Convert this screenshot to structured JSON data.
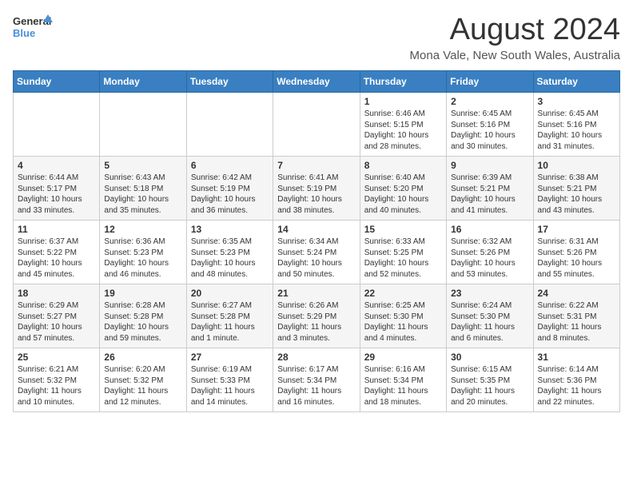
{
  "logo": {
    "general": "General",
    "blue": "Blue"
  },
  "title": "August 2024",
  "location": "Mona Vale, New South Wales, Australia",
  "days_header": [
    "Sunday",
    "Monday",
    "Tuesday",
    "Wednesday",
    "Thursday",
    "Friday",
    "Saturday"
  ],
  "weeks": [
    [
      {
        "day": "",
        "content": ""
      },
      {
        "day": "",
        "content": ""
      },
      {
        "day": "",
        "content": ""
      },
      {
        "day": "",
        "content": ""
      },
      {
        "day": "1",
        "content": "Sunrise: 6:46 AM\nSunset: 5:15 PM\nDaylight: 10 hours\nand 28 minutes."
      },
      {
        "day": "2",
        "content": "Sunrise: 6:45 AM\nSunset: 5:16 PM\nDaylight: 10 hours\nand 30 minutes."
      },
      {
        "day": "3",
        "content": "Sunrise: 6:45 AM\nSunset: 5:16 PM\nDaylight: 10 hours\nand 31 minutes."
      }
    ],
    [
      {
        "day": "4",
        "content": "Sunrise: 6:44 AM\nSunset: 5:17 PM\nDaylight: 10 hours\nand 33 minutes."
      },
      {
        "day": "5",
        "content": "Sunrise: 6:43 AM\nSunset: 5:18 PM\nDaylight: 10 hours\nand 35 minutes."
      },
      {
        "day": "6",
        "content": "Sunrise: 6:42 AM\nSunset: 5:19 PM\nDaylight: 10 hours\nand 36 minutes."
      },
      {
        "day": "7",
        "content": "Sunrise: 6:41 AM\nSunset: 5:19 PM\nDaylight: 10 hours\nand 38 minutes."
      },
      {
        "day": "8",
        "content": "Sunrise: 6:40 AM\nSunset: 5:20 PM\nDaylight: 10 hours\nand 40 minutes."
      },
      {
        "day": "9",
        "content": "Sunrise: 6:39 AM\nSunset: 5:21 PM\nDaylight: 10 hours\nand 41 minutes."
      },
      {
        "day": "10",
        "content": "Sunrise: 6:38 AM\nSunset: 5:21 PM\nDaylight: 10 hours\nand 43 minutes."
      }
    ],
    [
      {
        "day": "11",
        "content": "Sunrise: 6:37 AM\nSunset: 5:22 PM\nDaylight: 10 hours\nand 45 minutes."
      },
      {
        "day": "12",
        "content": "Sunrise: 6:36 AM\nSunset: 5:23 PM\nDaylight: 10 hours\nand 46 minutes."
      },
      {
        "day": "13",
        "content": "Sunrise: 6:35 AM\nSunset: 5:23 PM\nDaylight: 10 hours\nand 48 minutes."
      },
      {
        "day": "14",
        "content": "Sunrise: 6:34 AM\nSunset: 5:24 PM\nDaylight: 10 hours\nand 50 minutes."
      },
      {
        "day": "15",
        "content": "Sunrise: 6:33 AM\nSunset: 5:25 PM\nDaylight: 10 hours\nand 52 minutes."
      },
      {
        "day": "16",
        "content": "Sunrise: 6:32 AM\nSunset: 5:26 PM\nDaylight: 10 hours\nand 53 minutes."
      },
      {
        "day": "17",
        "content": "Sunrise: 6:31 AM\nSunset: 5:26 PM\nDaylight: 10 hours\nand 55 minutes."
      }
    ],
    [
      {
        "day": "18",
        "content": "Sunrise: 6:29 AM\nSunset: 5:27 PM\nDaylight: 10 hours\nand 57 minutes."
      },
      {
        "day": "19",
        "content": "Sunrise: 6:28 AM\nSunset: 5:28 PM\nDaylight: 10 hours\nand 59 minutes."
      },
      {
        "day": "20",
        "content": "Sunrise: 6:27 AM\nSunset: 5:28 PM\nDaylight: 11 hours\nand 1 minute."
      },
      {
        "day": "21",
        "content": "Sunrise: 6:26 AM\nSunset: 5:29 PM\nDaylight: 11 hours\nand 3 minutes."
      },
      {
        "day": "22",
        "content": "Sunrise: 6:25 AM\nSunset: 5:30 PM\nDaylight: 11 hours\nand 4 minutes."
      },
      {
        "day": "23",
        "content": "Sunrise: 6:24 AM\nSunset: 5:30 PM\nDaylight: 11 hours\nand 6 minutes."
      },
      {
        "day": "24",
        "content": "Sunrise: 6:22 AM\nSunset: 5:31 PM\nDaylight: 11 hours\nand 8 minutes."
      }
    ],
    [
      {
        "day": "25",
        "content": "Sunrise: 6:21 AM\nSunset: 5:32 PM\nDaylight: 11 hours\nand 10 minutes."
      },
      {
        "day": "26",
        "content": "Sunrise: 6:20 AM\nSunset: 5:32 PM\nDaylight: 11 hours\nand 12 minutes."
      },
      {
        "day": "27",
        "content": "Sunrise: 6:19 AM\nSunset: 5:33 PM\nDaylight: 11 hours\nand 14 minutes."
      },
      {
        "day": "28",
        "content": "Sunrise: 6:17 AM\nSunset: 5:34 PM\nDaylight: 11 hours\nand 16 minutes."
      },
      {
        "day": "29",
        "content": "Sunrise: 6:16 AM\nSunset: 5:34 PM\nDaylight: 11 hours\nand 18 minutes."
      },
      {
        "day": "30",
        "content": "Sunrise: 6:15 AM\nSunset: 5:35 PM\nDaylight: 11 hours\nand 20 minutes."
      },
      {
        "day": "31",
        "content": "Sunrise: 6:14 AM\nSunset: 5:36 PM\nDaylight: 11 hours\nand 22 minutes."
      }
    ]
  ]
}
